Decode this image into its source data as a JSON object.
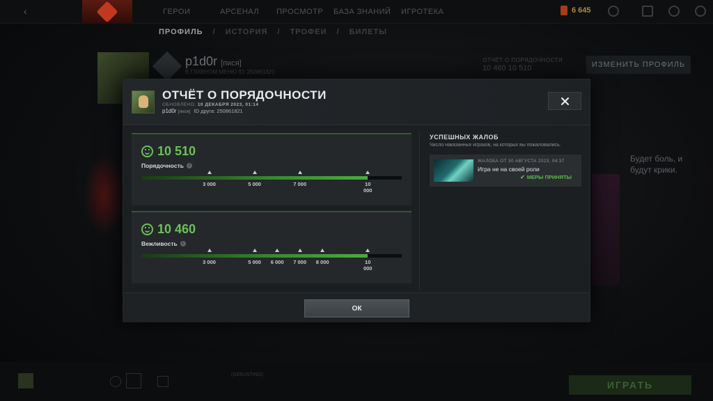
{
  "topbar": {
    "nav": [
      "ГЕРОИ",
      "АРСЕНАЛ",
      "ПРОСМОТР",
      "БАЗА ЗНАНИЙ",
      "ИГРОТЕКА"
    ],
    "gold": "6 645"
  },
  "subnav": {
    "items": [
      "ПРОФИЛЬ",
      "ИСТОРИЯ",
      "ТРОФЕИ",
      "БИЛЕТЫ"
    ],
    "separator": "/"
  },
  "background_profile": {
    "name": "p1d0r",
    "tag": "[пися]",
    "status": "В ГЛАВНОМ МЕНЮ",
    "id": "ID: 250861821",
    "report_label": "ОТЧЁТ О ПОРЯДОЧНОСТИ",
    "report_values": "10 460   10 510",
    "edit_button": "ИЗМЕНИТЬ ПРОФИЛЬ",
    "quote": "Будет боль, и будут крики."
  },
  "modal": {
    "title": "ОТЧЁТ О ПОРЯДОЧНОСТИ",
    "updated_label": "ОБНОВЛЕНО:",
    "updated_value": "10 ДЕКАБРЯ 2023, 01:14",
    "username": "p1d0r",
    "user_tag": "[пися]",
    "friend_id": "ID друга: 250861821",
    "conduct": {
      "score": "10 510",
      "label": "Порядочность",
      "info": "i",
      "fill": 0.87,
      "ticks": [
        {
          "label": "3 000",
          "value": 3000
        },
        {
          "label": "5 000",
          "value": 5000
        },
        {
          "label": "7 000",
          "value": 7000
        },
        {
          "label": "10 000",
          "value": 10000
        }
      ]
    },
    "politeness": {
      "score": "10 460",
      "label": "Вежливость",
      "info": "i",
      "fill": 0.87,
      "ticks": [
        {
          "label": "3 000",
          "value": 3000
        },
        {
          "label": "5 000",
          "value": 5000
        },
        {
          "label": "6 000",
          "value": 6000
        },
        {
          "label": "7 000",
          "value": 7000
        },
        {
          "label": "8 000",
          "value": 8000
        },
        {
          "label": "10 000",
          "value": 10000
        }
      ]
    },
    "reports": {
      "title": "УСПЕШНЫХ ЖАЛОБ",
      "subtitle": "Число наказанных игроков, на которых вы пожаловались.",
      "items": [
        {
          "date": "ЖАЛОБА ОТ 30 АВГУСТА 2023, 04:37",
          "reason": "Игра не на своей роли",
          "status": "МЕРЫ ПРИНЯТЫ",
          "status_icon": "✔"
        }
      ]
    },
    "ok_button": "ОК",
    "close_symbol": "✕"
  },
  "bottombar": {
    "play_button": "ИГРАТЬ",
    "chat_label": "(DEBUSTING):"
  },
  "colors": {
    "accent_green": "#6cc158",
    "bar_green": "#4caa3e",
    "status_green": "#62b552"
  }
}
